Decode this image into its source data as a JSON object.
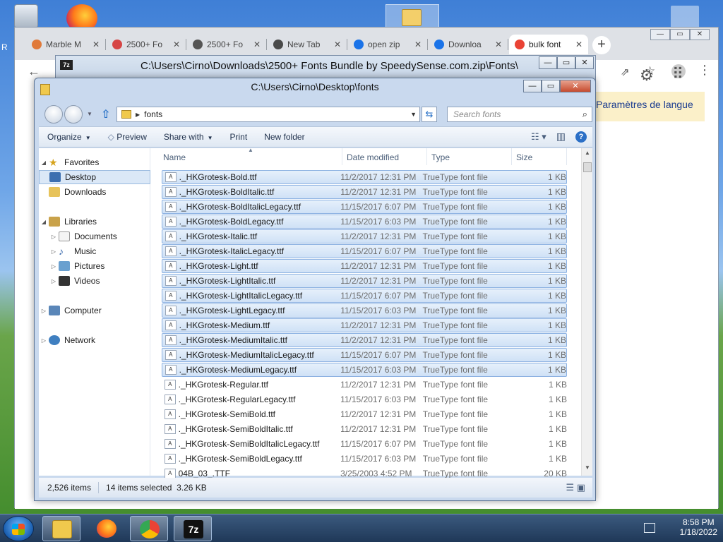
{
  "desktop": {
    "left_letter": "R"
  },
  "chrome": {
    "tabs": [
      {
        "label": "Marble M",
        "fav": "#e07a3a"
      },
      {
        "label": "2500+ Fo",
        "fav": "#d64545"
      },
      {
        "label": "2500+ Fo",
        "fav": "#555555"
      },
      {
        "label": "New Tab",
        "fav": "#4a4a4a"
      },
      {
        "label": "open zip",
        "fav": "#1a73e8"
      },
      {
        "label": "Downloa",
        "fav": "#1a73e8"
      },
      {
        "label": "bulk font",
        "fav": "#ea4335"
      }
    ],
    "new_tab": "+",
    "banner_text": "Paramètres de langue"
  },
  "sevenzip": {
    "icon": "7z",
    "title": "C:\\Users\\Cirno\\Downloads\\2500+ Fonts Bundle by SpeedySense.com.zip\\Fonts\\"
  },
  "explorer": {
    "title": "C:\\Users\\Cirno\\Desktop\\fonts",
    "address": "fonts",
    "search_placeholder": "Search fonts",
    "commands": {
      "organize": "Organize",
      "preview": "Preview",
      "share_with": "Share with",
      "print": "Print",
      "new_folder": "New folder"
    },
    "nav": {
      "favorites": "Favorites",
      "desktop": "Desktop",
      "downloads": "Downloads",
      "libraries": "Libraries",
      "documents": "Documents",
      "music": "Music",
      "pictures": "Pictures",
      "videos": "Videos",
      "computer": "Computer",
      "network": "Network"
    },
    "columns": {
      "name": "Name",
      "date": "Date modified",
      "type": "Type",
      "size": "Size"
    },
    "files": [
      {
        "name": "._HKGrotesk-Bold.ttf",
        "date": "11/2/2017 12:31 PM",
        "type": "TrueType font file",
        "size": "1 KB",
        "selected": true
      },
      {
        "name": "._HKGrotesk-BoldItalic.ttf",
        "date": "11/2/2017 12:31 PM",
        "type": "TrueType font file",
        "size": "1 KB",
        "selected": true
      },
      {
        "name": "._HKGrotesk-BoldItalicLegacy.ttf",
        "date": "11/15/2017 6:07 PM",
        "type": "TrueType font file",
        "size": "1 KB",
        "selected": true
      },
      {
        "name": "._HKGrotesk-BoldLegacy.ttf",
        "date": "11/15/2017 6:03 PM",
        "type": "TrueType font file",
        "size": "1 KB",
        "selected": true
      },
      {
        "name": "._HKGrotesk-Italic.ttf",
        "date": "11/2/2017 12:31 PM",
        "type": "TrueType font file",
        "size": "1 KB",
        "selected": true
      },
      {
        "name": "._HKGrotesk-ItalicLegacy.ttf",
        "date": "11/15/2017 6:07 PM",
        "type": "TrueType font file",
        "size": "1 KB",
        "selected": true
      },
      {
        "name": "._HKGrotesk-Light.ttf",
        "date": "11/2/2017 12:31 PM",
        "type": "TrueType font file",
        "size": "1 KB",
        "selected": true
      },
      {
        "name": "._HKGrotesk-LightItalic.ttf",
        "date": "11/2/2017 12:31 PM",
        "type": "TrueType font file",
        "size": "1 KB",
        "selected": true
      },
      {
        "name": "._HKGrotesk-LightItalicLegacy.ttf",
        "date": "11/15/2017 6:07 PM",
        "type": "TrueType font file",
        "size": "1 KB",
        "selected": true
      },
      {
        "name": "._HKGrotesk-LightLegacy.ttf",
        "date": "11/15/2017 6:03 PM",
        "type": "TrueType font file",
        "size": "1 KB",
        "selected": true
      },
      {
        "name": "._HKGrotesk-Medium.ttf",
        "date": "11/2/2017 12:31 PM",
        "type": "TrueType font file",
        "size": "1 KB",
        "selected": true
      },
      {
        "name": "._HKGrotesk-MediumItalic.ttf",
        "date": "11/2/2017 12:31 PM",
        "type": "TrueType font file",
        "size": "1 KB",
        "selected": true
      },
      {
        "name": "._HKGrotesk-MediumItalicLegacy.ttf",
        "date": "11/15/2017 6:07 PM",
        "type": "TrueType font file",
        "size": "1 KB",
        "selected": true
      },
      {
        "name": "._HKGrotesk-MediumLegacy.ttf",
        "date": "11/15/2017 6:03 PM",
        "type": "TrueType font file",
        "size": "1 KB",
        "selected": true
      },
      {
        "name": "._HKGrotesk-Regular.ttf",
        "date": "11/2/2017 12:31 PM",
        "type": "TrueType font file",
        "size": "1 KB",
        "selected": false
      },
      {
        "name": "._HKGrotesk-RegularLegacy.ttf",
        "date": "11/15/2017 6:03 PM",
        "type": "TrueType font file",
        "size": "1 KB",
        "selected": false
      },
      {
        "name": "._HKGrotesk-SemiBold.ttf",
        "date": "11/2/2017 12:31 PM",
        "type": "TrueType font file",
        "size": "1 KB",
        "selected": false
      },
      {
        "name": "._HKGrotesk-SemiBoldItalic.ttf",
        "date": "11/2/2017 12:31 PM",
        "type": "TrueType font file",
        "size": "1 KB",
        "selected": false
      },
      {
        "name": "._HKGrotesk-SemiBoldItalicLegacy.ttf",
        "date": "11/15/2017 6:07 PM",
        "type": "TrueType font file",
        "size": "1 KB",
        "selected": false
      },
      {
        "name": "._HKGrotesk-SemiBoldLegacy.ttf",
        "date": "11/15/2017 6:03 PM",
        "type": "TrueType font file",
        "size": "1 KB",
        "selected": false
      },
      {
        "name": "04B_03_.TTF",
        "date": "3/25/2003 4:52 PM",
        "type": "TrueType font file",
        "size": "20 KB",
        "selected": false
      }
    ],
    "status": {
      "items": "2,526 items",
      "selected": "14 items selected  3.26 KB"
    }
  },
  "taskbar": {
    "sevenzip_label": "7z",
    "time": "8:58 PM",
    "date": "1/18/2022"
  }
}
